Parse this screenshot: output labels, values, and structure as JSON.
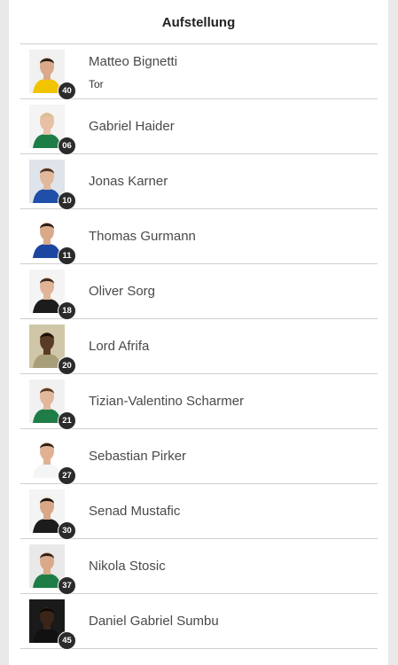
{
  "title": "Aufstellung",
  "players": [
    {
      "name": "Matteo Bignetti",
      "number": "40",
      "position": "Tor",
      "shirt": "#f2c400",
      "skin": "#d9a98a",
      "hair": "#2a1d15",
      "bg": "#f1f1f1"
    },
    {
      "name": "Gabriel Haider",
      "number": "06",
      "position": "",
      "shirt": "#1e7d47",
      "skin": "#e8c0a5",
      "hair": "#d8c08a",
      "bg": "#f4f4f4"
    },
    {
      "name": "Jonas Karner",
      "number": "10",
      "position": "",
      "shirt": "#1f4fa8",
      "skin": "#e2b89c",
      "hair": "#4b3326",
      "bg": "#dfe4ea"
    },
    {
      "name": "Thomas Gurmann",
      "number": "11",
      "position": "",
      "shirt": "#1d46a0",
      "skin": "#d9a98a",
      "hair": "#2a1d15",
      "bg": "#ffffff"
    },
    {
      "name": "Oliver Sorg",
      "number": "18",
      "position": "",
      "shirt": "#1c1c1c",
      "skin": "#e1b497",
      "hair": "#3b2a1e",
      "bg": "#f4f4f4"
    },
    {
      "name": "Lord Afrifa",
      "number": "20",
      "position": "",
      "shirt": "#a89e7a",
      "skin": "#5a3b25",
      "hair": "#1a1108",
      "bg": "#cfc7a7"
    },
    {
      "name": "Tizian-Valentino Scharmer",
      "number": "21",
      "position": "",
      "shirt": "#1e7d47",
      "skin": "#e2b89c",
      "hair": "#5a3a24",
      "bg": "#f1f1f1"
    },
    {
      "name": "Sebastian Pirker",
      "number": "27",
      "position": "",
      "shirt": "#f5f5f5",
      "skin": "#e0b293",
      "hair": "#2f2018",
      "bg": "#ffffff"
    },
    {
      "name": "Senad Mustafic",
      "number": "30",
      "position": "",
      "shirt": "#1c1c1c",
      "skin": "#d7a787",
      "hair": "#1e150f",
      "bg": "#f4f4f4"
    },
    {
      "name": "Nikola Stosic",
      "number": "37",
      "position": "",
      "shirt": "#1e7d47",
      "skin": "#d9a98a",
      "hair": "#2f2018",
      "bg": "#e9e9e9"
    },
    {
      "name": "Daniel Gabriel Sumbu",
      "number": "45",
      "position": "",
      "shirt": "#111111",
      "skin": "#3b2418",
      "hair": "#0d0905",
      "bg": "#1a1a1a"
    }
  ]
}
